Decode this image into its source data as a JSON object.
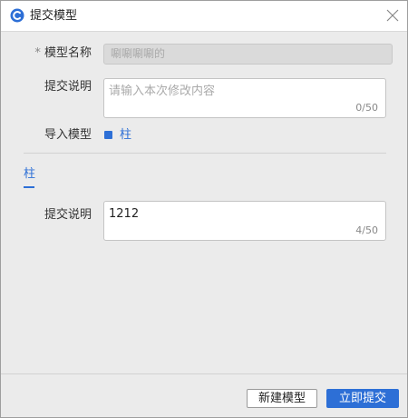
{
  "dialog": {
    "title": "提交模型",
    "app_icon": "app-logo-icon",
    "close_icon": "close-icon"
  },
  "form": {
    "model_name": {
      "required_mark": "*",
      "label": "模型名称",
      "value": "唰唰唰唰的"
    },
    "commit_note": {
      "label": "提交说明",
      "placeholder": "请输入本次修改内容",
      "count": "0/50"
    },
    "import_model": {
      "label": "导入模型",
      "option_label": "柱",
      "checked": true
    }
  },
  "tabs": [
    {
      "label": "柱",
      "active": true
    }
  ],
  "tab_form": {
    "commit_note": {
      "label": "提交说明",
      "value": "1212",
      "count": "4/50"
    }
  },
  "footer": {
    "new_model_label": "新建模型",
    "submit_label": "立即提交"
  },
  "colors": {
    "accent": "#2d6fd6",
    "background": "#ebebeb"
  }
}
